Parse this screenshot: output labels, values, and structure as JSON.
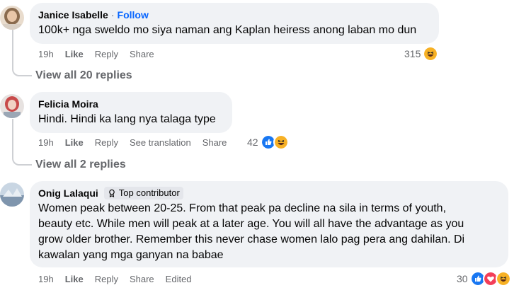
{
  "comments": [
    {
      "author": "Janice Isabelle",
      "separator": "·",
      "follow": "Follow",
      "text": "100k+ nga sweldo mo siya naman ang Kaplan heiress anong laban mo dun",
      "time": "19h",
      "like": "Like",
      "reply": "Reply",
      "share": "Share",
      "reaction_count": "315",
      "reactions": [
        "haha-icon"
      ],
      "view_replies": "View all 20 replies"
    },
    {
      "author": "Felicia Moira",
      "text": "Hindi. Hindi ka lang nya talaga type",
      "time": "19h",
      "like": "Like",
      "reply": "Reply",
      "see_translation": "See translation",
      "share": "Share",
      "reaction_count": "42",
      "reactions": [
        "like-icon",
        "haha-icon"
      ],
      "view_replies": "View all 2 replies"
    },
    {
      "author": "Onig Lalaqui",
      "badge": "Top contributor",
      "text_lines": [
        "Women peak between 20-25. From that peak pa decline na sila in terms of youth,",
        "beauty etc. While men will peak at a later age. You will all have the advantage as you",
        "grow older brother. Remember this never chase women lalo pag pera ang dahilan. Di",
        "kawalan yang mga ganyan na babae"
      ],
      "time": "19h",
      "like": "Like",
      "reply": "Reply",
      "share": "Share",
      "edited": "Edited",
      "reaction_count": "30",
      "reactions": [
        "like-icon",
        "heart-icon",
        "haha-icon"
      ]
    }
  ],
  "colors": {
    "bubble": "#f0f2f5",
    "meta_text": "#65676b",
    "follow_blue": "#0866ff",
    "like_blue": "#1877f2",
    "heart_red": "#f33e58",
    "haha_yellow": "#f7b125"
  }
}
